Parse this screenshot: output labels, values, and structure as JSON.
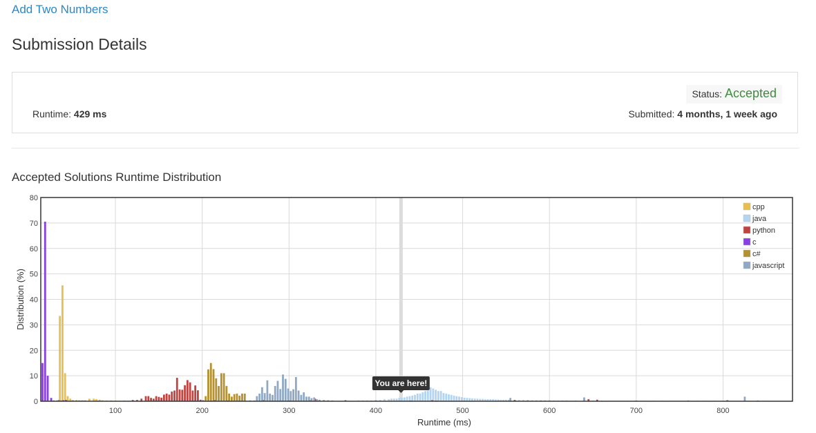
{
  "problem_title": "Add Two Numbers",
  "page_title": "Submission Details",
  "details": {
    "runtime_label": "Runtime: ",
    "runtime_value": "429 ms",
    "status_label": "Status: ",
    "status_value": "Accepted",
    "submitted_label": "Submitted: ",
    "submitted_value": "4 months, 1 week ago"
  },
  "colors": {
    "cpp": "#e8bf4f",
    "java": "#b3d4f1",
    "python": "#c1433f",
    "c": "#8840e0",
    "c#": "#b5902e",
    "javascript": "#8fa8c4",
    "accepted": "#3f8b3f",
    "link": "#2a88c6"
  },
  "chart_data": {
    "type": "bar",
    "title": "Accepted Solutions Runtime Distribution",
    "xlabel": "Runtime (ms)",
    "ylabel": "Distribution (%)",
    "xlim": [
      14,
      880
    ],
    "ylim": [
      0,
      80
    ],
    "x_ticks": [
      100,
      200,
      300,
      400,
      500,
      600,
      700,
      800
    ],
    "y_ticks": [
      0,
      10,
      20,
      30,
      40,
      50,
      60,
      70,
      80
    ],
    "grid": true,
    "legend_position": "top-right",
    "marker": {
      "x": 429,
      "label": "You are here!"
    },
    "series": [
      {
        "name": "cpp",
        "color": "#e8bf4f",
        "points": [
          [
            36,
            33.5
          ],
          [
            39,
            45.5
          ],
          [
            42,
            11
          ],
          [
            45,
            2
          ],
          [
            48,
            1
          ],
          [
            51,
            0.5
          ],
          [
            55,
            0.5
          ],
          [
            58,
            0.4
          ],
          [
            62,
            0.4
          ],
          [
            65,
            0.4
          ],
          [
            70,
            1
          ],
          [
            75,
            1
          ],
          [
            78,
            0.8
          ],
          [
            82,
            0.6
          ],
          [
            85,
            0.4
          ],
          [
            90,
            0.3
          ],
          [
            95,
            0.3
          ],
          [
            105,
            0.2
          ],
          [
            115,
            0.2
          ],
          [
            125,
            0.3
          ],
          [
            130,
            0.2
          ],
          [
            140,
            0.2
          ],
          [
            150,
            0.2
          ]
        ]
      },
      {
        "name": "java",
        "color": "#b3d4f1",
        "points": [
          [
            380,
            0.3
          ],
          [
            385,
            0.3
          ],
          [
            390,
            0.3
          ],
          [
            395,
            0.3
          ],
          [
            400,
            0.5
          ],
          [
            405,
            0.5
          ],
          [
            410,
            0.8
          ],
          [
            415,
            0.8
          ],
          [
            418,
            1
          ],
          [
            421,
            1
          ],
          [
            424,
            1
          ],
          [
            427,
            1.3
          ],
          [
            430,
            1.3
          ],
          [
            433,
            1.5
          ],
          [
            436,
            1.8
          ],
          [
            439,
            2
          ],
          [
            442,
            2.2
          ],
          [
            445,
            2.5
          ],
          [
            448,
            3
          ],
          [
            451,
            3
          ],
          [
            454,
            3.5
          ],
          [
            457,
            4
          ],
          [
            460,
            4.2
          ],
          [
            463,
            5.5
          ],
          [
            466,
            5
          ],
          [
            469,
            4.5
          ],
          [
            472,
            4
          ],
          [
            475,
            4
          ],
          [
            478,
            3.2
          ],
          [
            481,
            3
          ],
          [
            484,
            2.7
          ],
          [
            487,
            2.5
          ],
          [
            490,
            2.2
          ],
          [
            493,
            2
          ],
          [
            496,
            1.8
          ],
          [
            499,
            1.6
          ],
          [
            502,
            1.4
          ],
          [
            505,
            1.3
          ],
          [
            508,
            1.2
          ],
          [
            511,
            1.1
          ],
          [
            514,
            1.0
          ],
          [
            517,
            1.0
          ],
          [
            520,
            0.9
          ],
          [
            523,
            0.9
          ],
          [
            526,
            0.8
          ],
          [
            529,
            0.8
          ],
          [
            532,
            0.8
          ],
          [
            535,
            0.8
          ],
          [
            538,
            0.7
          ],
          [
            541,
            0.7
          ],
          [
            544,
            0.6
          ],
          [
            547,
            0.6
          ],
          [
            550,
            0.6
          ],
          [
            553,
            0.6
          ],
          [
            560,
            0.5
          ],
          [
            565,
            0.5
          ],
          [
            570,
            0.5
          ],
          [
            575,
            0.5
          ],
          [
            580,
            0.4
          ],
          [
            585,
            0.4
          ],
          [
            590,
            0.4
          ],
          [
            595,
            0.4
          ],
          [
            600,
            0.4
          ],
          [
            605,
            0.3
          ],
          [
            610,
            0.3
          ],
          [
            615,
            0.3
          ],
          [
            620,
            0.3
          ],
          [
            630,
            0.3
          ],
          [
            640,
            0.3
          ],
          [
            650,
            0.3
          ],
          [
            660,
            0.2
          ],
          [
            670,
            0.2
          ],
          [
            680,
            0.2
          ],
          [
            690,
            0.2
          ],
          [
            700,
            0.2
          ],
          [
            710,
            0.2
          ],
          [
            720,
            0.2
          ],
          [
            730,
            0.2
          ],
          [
            740,
            0.2
          ],
          [
            750,
            0.2
          ],
          [
            760,
            0.2
          ],
          [
            770,
            0.2
          ],
          [
            780,
            0.2
          ],
          [
            790,
            0.2
          ],
          [
            800,
            0.2
          ],
          [
            810,
            0.2
          ],
          [
            820,
            0.2
          ],
          [
            830,
            0.2
          ],
          [
            840,
            0.2
          ],
          [
            850,
            0.2
          ]
        ]
      },
      {
        "name": "python",
        "color": "#c1433f",
        "points": [
          [
            120,
            0.5
          ],
          [
            125,
            0.5
          ],
          [
            130,
            1
          ],
          [
            135,
            2
          ],
          [
            138,
            2
          ],
          [
            141,
            1.3
          ],
          [
            144,
            1
          ],
          [
            147,
            2
          ],
          [
            150,
            1.7
          ],
          [
            153,
            1.4
          ],
          [
            156,
            2.6
          ],
          [
            159,
            3
          ],
          [
            162,
            2.6
          ],
          [
            165,
            3.8
          ],
          [
            168,
            4.2
          ],
          [
            171,
            9.2
          ],
          [
            174,
            4.6
          ],
          [
            177,
            4.5
          ],
          [
            180,
            6.3
          ],
          [
            183,
            8.3
          ],
          [
            186,
            7.4
          ],
          [
            189,
            4.2
          ],
          [
            192,
            6.2
          ],
          [
            195,
            4.3
          ],
          [
            198,
            0.6
          ],
          [
            201,
            0.4
          ],
          [
            215,
            0.5
          ],
          [
            230,
            0.3
          ],
          [
            240,
            0.3
          ],
          [
            255,
            0.3
          ],
          [
            270,
            0.5
          ],
          [
            290,
            0.5
          ],
          [
            305,
            0.3
          ],
          [
            320,
            0.3
          ],
          [
            325,
            0.4
          ],
          [
            330,
            1
          ],
          [
            335,
            0.5
          ],
          [
            340,
            0.3
          ],
          [
            345,
            0.2
          ],
          [
            365,
            0.4
          ],
          [
            465,
            0.4
          ],
          [
            560,
            0.5
          ],
          [
            590,
            0.2
          ],
          [
            645,
            0.8
          ],
          [
            655,
            0.6
          ],
          [
            805,
            0.4
          ]
        ]
      },
      {
        "name": "c",
        "color": "#8840e0",
        "points": [
          [
            16,
            15
          ],
          [
            19,
            70.5
          ],
          [
            22,
            10
          ],
          [
            26,
            1.3
          ],
          [
            29,
            0.3
          ],
          [
            33,
            0.3
          ],
          [
            40,
            0.4
          ],
          [
            43,
            0.5
          ],
          [
            50,
            0.2
          ],
          [
            60,
            0.2
          ],
          [
            65,
            0.2
          ],
          [
            80,
            0.2
          ],
          [
            110,
            0.2
          ],
          [
            150,
            0.2
          ],
          [
            180,
            0.2
          ],
          [
            210,
            0.2
          ],
          [
            250,
            0.2
          ],
          [
            300,
            0.3
          ],
          [
            400,
            0.2
          ]
        ]
      },
      {
        "name": "c#",
        "color": "#b5902e",
        "points": [
          [
            35,
            0.5
          ],
          [
            38,
            0.3
          ],
          [
            100,
            0.2
          ],
          [
            140,
            0.2
          ],
          [
            204,
            2
          ],
          [
            207,
            12.5
          ],
          [
            210,
            15
          ],
          [
            213,
            12.6
          ],
          [
            216,
            9
          ],
          [
            219,
            6
          ],
          [
            222,
            11
          ],
          [
            225,
            11
          ],
          [
            228,
            6
          ],
          [
            231,
            3
          ],
          [
            234,
            1.8
          ],
          [
            237,
            2.8
          ],
          [
            240,
            3
          ],
          [
            243,
            2.2
          ],
          [
            246,
            3
          ],
          [
            249,
            3
          ]
        ]
      },
      {
        "name": "javascript",
        "color": "#8fa8c4",
        "points": [
          [
            255,
            0.3
          ],
          [
            260,
            0.3
          ],
          [
            263,
            2
          ],
          [
            266,
            3
          ],
          [
            269,
            5.5
          ],
          [
            272,
            3.2
          ],
          [
            275,
            8.2
          ],
          [
            278,
            3
          ],
          [
            281,
            2.5
          ],
          [
            284,
            6
          ],
          [
            287,
            8
          ],
          [
            290,
            4.8
          ],
          [
            293,
            10.5
          ],
          [
            296,
            8.8
          ],
          [
            299,
            5
          ],
          [
            302,
            4
          ],
          [
            305,
            4.7
          ],
          [
            308,
            9.5
          ],
          [
            311,
            4.2
          ],
          [
            314,
            2.5
          ],
          [
            317,
            3.5
          ],
          [
            320,
            1.8
          ],
          [
            323,
            1.8
          ],
          [
            326,
            1.2
          ],
          [
            329,
            1.5
          ],
          [
            332,
            0.8
          ],
          [
            335,
            0.6
          ],
          [
            340,
            0.5
          ],
          [
            345,
            0.4
          ],
          [
            350,
            0.3
          ],
          [
            400,
            0.3
          ],
          [
            440,
            0.3
          ],
          [
            470,
            0.3
          ],
          [
            555,
            1.3
          ],
          [
            575,
            0.3
          ],
          [
            640,
            1.5
          ],
          [
            700,
            0.3
          ],
          [
            760,
            0.3
          ],
          [
            825,
            1.8
          ],
          [
            840,
            0.3
          ]
        ]
      }
    ]
  }
}
